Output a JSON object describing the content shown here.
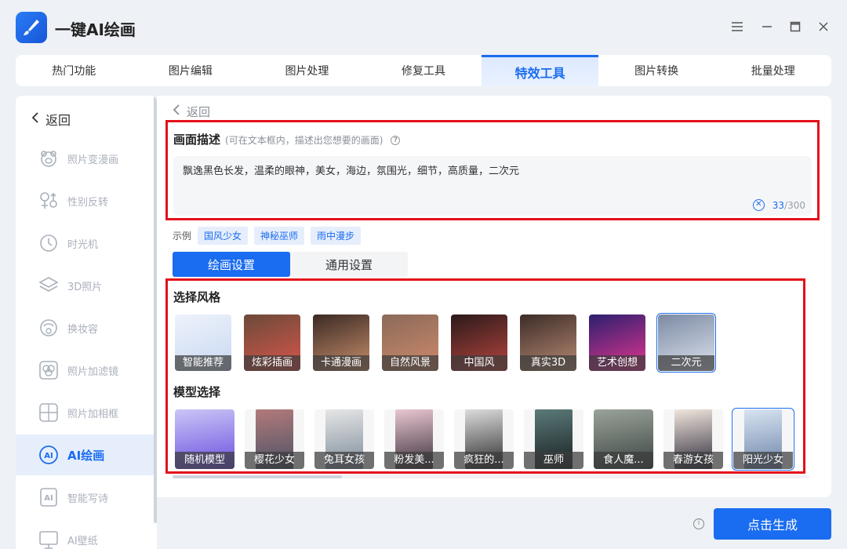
{
  "app": {
    "title": "一键AI绘画"
  },
  "tabs": [
    "热门功能",
    "图片编辑",
    "图片处理",
    "修复工具",
    "特效工具",
    "图片转换",
    "批量处理"
  ],
  "active_tab": 4,
  "sidebar": {
    "back_label": "返回",
    "items": [
      {
        "label": "照片变漫画",
        "icon": "bear-face-icon"
      },
      {
        "label": "性别反转",
        "icon": "gender-icon"
      },
      {
        "label": "时光机",
        "icon": "clock-icon"
      },
      {
        "label": "3D照片",
        "icon": "layers-icon"
      },
      {
        "label": "换妆容",
        "icon": "makeup-icon"
      },
      {
        "label": "照片加滤镜",
        "icon": "filter-icon"
      },
      {
        "label": "照片加相框",
        "icon": "frame-icon"
      },
      {
        "label": "AI绘画",
        "icon": "ai-paint-icon"
      },
      {
        "label": "智能写诗",
        "icon": "ai-poem-icon"
      },
      {
        "label": "AI壁纸",
        "icon": "wallpaper-icon"
      }
    ],
    "active_index": 7
  },
  "main": {
    "back_label": "返回",
    "description": {
      "title": "画面描述",
      "hint": "(可在文本框内，描述出您想要的画面)",
      "value": "飘逸黑色长发，温柔的眼神，美女，海边，氛围光，细节，高质量，二次元",
      "count": "33",
      "max": "/300"
    },
    "examples": {
      "label": "示例",
      "chips": [
        "国风少女",
        "神秘巫师",
        "雨中漫步"
      ]
    },
    "settings_tabs": [
      "绘画设置",
      "通用设置"
    ],
    "styles": {
      "title": "选择风格",
      "items": [
        {
          "label": "智能推荐",
          "colors": [
            "#eef3fb",
            "#c7d7f1"
          ]
        },
        {
          "label": "炫彩插画",
          "colors": [
            "#6b4a3a",
            "#d9564a"
          ]
        },
        {
          "label": "卡通漫画",
          "colors": [
            "#3a2a24",
            "#c98f6b"
          ]
        },
        {
          "label": "自然风景",
          "colors": [
            "#8a6a5a",
            "#cf8a6a"
          ]
        },
        {
          "label": "中国风",
          "colors": [
            "#2a1a1a",
            "#b8453f"
          ]
        },
        {
          "label": "真实3D",
          "colors": [
            "#3c2c28",
            "#b98b74"
          ]
        },
        {
          "label": "艺术创想",
          "colors": [
            "#2c1f6e",
            "#e4368f"
          ]
        },
        {
          "label": "二次元",
          "colors": [
            "#7c8aa3",
            "#dde3ee"
          ]
        }
      ],
      "selected": 7
    },
    "models": {
      "title": "模型选择",
      "items": [
        {
          "label": "随机模型",
          "colors": [
            "#c9c6f6",
            "#6c4ee0"
          ]
        },
        {
          "label": "樱花少女",
          "colors": [
            "#b37a7a",
            "#4a5266"
          ]
        },
        {
          "label": "兔耳女孩",
          "colors": [
            "#e6e6e6",
            "#7b8a98"
          ]
        },
        {
          "label": "粉发美...",
          "colors": [
            "#e8c7d1",
            "#3a2e3a"
          ]
        },
        {
          "label": "疯狂的...",
          "colors": [
            "#dcdcdc",
            "#2b2b2b"
          ]
        },
        {
          "label": "巫师",
          "colors": [
            "#5a7a78",
            "#1a1f22"
          ]
        },
        {
          "label": "食人魔...",
          "colors": [
            "#9aa39a",
            "#3b4340"
          ]
        },
        {
          "label": "春游女孩",
          "colors": [
            "#f0e6dd",
            "#2e2a3a"
          ]
        },
        {
          "label": "阳光少女",
          "colors": [
            "#d8e4f2",
            "#6d84a8"
          ]
        }
      ],
      "selected": 8
    }
  },
  "generate_label": "点击生成"
}
